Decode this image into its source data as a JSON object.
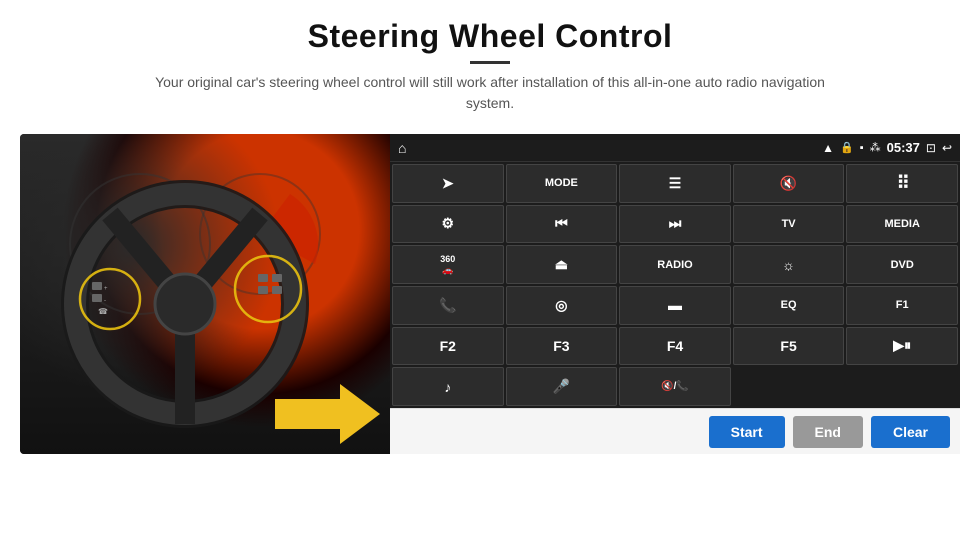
{
  "page": {
    "title": "Steering Wheel Control",
    "subtitle": "Your original car's steering wheel control will still work after installation of this all-in-one auto radio navigation system.",
    "divider": true
  },
  "status_bar": {
    "wifi_icon": "wifi",
    "lock_icon": "lock",
    "sim_icon": "sim",
    "bt_icon": "bluetooth",
    "time": "05:37",
    "window_icon": "window",
    "back_icon": "back",
    "home_icon": "home"
  },
  "grid_buttons": [
    {
      "id": "nav",
      "label": "",
      "icon": "➤",
      "row": 1,
      "col": 1
    },
    {
      "id": "mode",
      "label": "MODE",
      "icon": "",
      "row": 1,
      "col": 2
    },
    {
      "id": "list",
      "label": "",
      "icon": "≡",
      "row": 1,
      "col": 3
    },
    {
      "id": "mute",
      "label": "",
      "icon": "🔇",
      "row": 1,
      "col": 4
    },
    {
      "id": "apps",
      "label": "",
      "icon": "⠿",
      "row": 1,
      "col": 5
    },
    {
      "id": "settings",
      "label": "",
      "icon": "⚙",
      "row": 2,
      "col": 1
    },
    {
      "id": "prev",
      "label": "",
      "icon": "◀◀",
      "row": 2,
      "col": 2
    },
    {
      "id": "next",
      "label": "",
      "icon": "▶▶",
      "row": 2,
      "col": 3
    },
    {
      "id": "tv",
      "label": "TV",
      "icon": "",
      "row": 2,
      "col": 4
    },
    {
      "id": "media",
      "label": "MEDIA",
      "icon": "",
      "row": 2,
      "col": 5
    },
    {
      "id": "cam360",
      "label": "360",
      "icon": "🚗",
      "row": 3,
      "col": 1
    },
    {
      "id": "eject",
      "label": "",
      "icon": "⏏",
      "row": 3,
      "col": 2
    },
    {
      "id": "radio",
      "label": "RADIO",
      "icon": "",
      "row": 3,
      "col": 3
    },
    {
      "id": "brightness",
      "label": "",
      "icon": "☀",
      "row": 3,
      "col": 4
    },
    {
      "id": "dvd",
      "label": "DVD",
      "icon": "",
      "row": 3,
      "col": 5
    },
    {
      "id": "phone",
      "label": "",
      "icon": "📞",
      "row": 4,
      "col": 1
    },
    {
      "id": "browse",
      "label": "",
      "icon": "🌀",
      "row": 4,
      "col": 2
    },
    {
      "id": "screen",
      "label": "",
      "icon": "▬",
      "row": 4,
      "col": 3
    },
    {
      "id": "eq",
      "label": "EQ",
      "icon": "",
      "row": 4,
      "col": 4
    },
    {
      "id": "f1",
      "label": "F1",
      "icon": "",
      "row": 4,
      "col": 5
    },
    {
      "id": "f2",
      "label": "F2",
      "icon": "",
      "row": 5,
      "col": 1
    },
    {
      "id": "f3",
      "label": "F3",
      "icon": "",
      "row": 5,
      "col": 2
    },
    {
      "id": "f4",
      "label": "F4",
      "icon": "",
      "row": 5,
      "col": 3
    },
    {
      "id": "f5",
      "label": "F5",
      "icon": "",
      "row": 5,
      "col": 4
    },
    {
      "id": "playpause",
      "label": "",
      "icon": "▶⏸",
      "row": 5,
      "col": 5
    },
    {
      "id": "music",
      "label": "",
      "icon": "♪",
      "row": 6,
      "col": 1
    },
    {
      "id": "mic",
      "label": "",
      "icon": "🎤",
      "row": 6,
      "col": 2
    },
    {
      "id": "hangup",
      "label": "",
      "icon": "📵",
      "row": 6,
      "col": 3
    }
  ],
  "bottom_buttons": {
    "start_label": "Start",
    "end_label": "End",
    "clear_label": "Clear"
  }
}
